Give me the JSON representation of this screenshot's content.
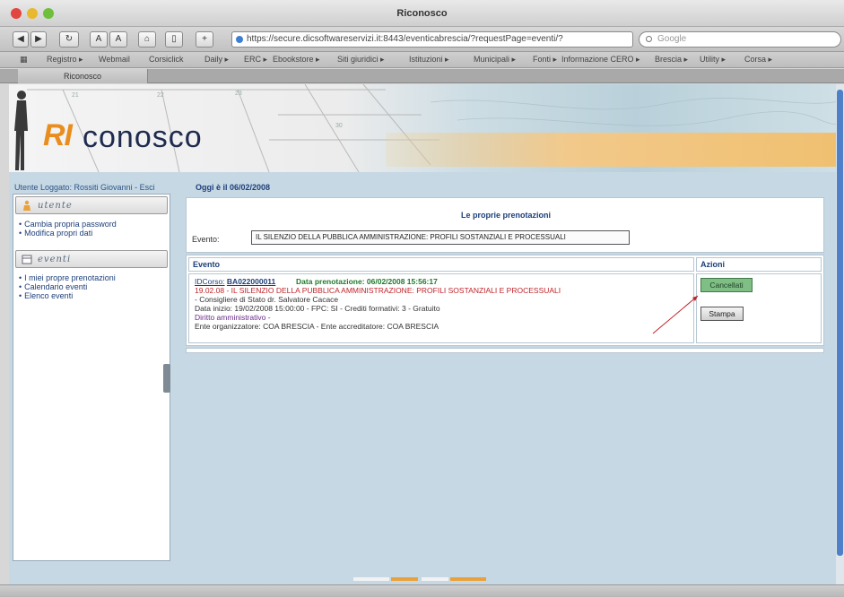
{
  "window": {
    "title": "Riconosco",
    "url": "https://secure.dicsoftwareservizi.it:8443/eventicabrescia/?requestPage=eventi/?",
    "search_placeholder": "Google"
  },
  "bookmarks": [
    "Registro ▸",
    "Webmail",
    "Corsiclick",
    "Daily ▸",
    "ERC ▸",
    "Ebookstore ▸",
    "Siti giuridici ▸",
    "Istituzioni ▸",
    "Municipali ▸",
    "Fonti ▸",
    "Informazione CERO ▸",
    "Brescia ▸",
    "Utility ▸",
    "Corsa ▸"
  ],
  "tab": {
    "label": "Riconosco"
  },
  "banner": {
    "logo_ri": "RI",
    "logo_rest": "conosco"
  },
  "user": {
    "logged_label": "Utente Loggato: Rossiti Giovanni - Esci",
    "date_label": "Oggi è il 06/02/2008"
  },
  "sidebar": {
    "section1_title": "utente",
    "section1_links": [
      "Cambia propria password",
      "Modifica propri dati"
    ],
    "section2_title": "eventi",
    "section2_links": [
      "I miei propre prenotazioni",
      "Calendario eventi",
      "Elenco eventi"
    ]
  },
  "main": {
    "title": "Le proprie prenotazioni",
    "event_label": "Evento:",
    "event_selected": "IL SILENZIO DELLA PUBBLICA AMMINISTRAZIONE: PROFILI SOSTANZIALI E PROCESSUALI",
    "col_evento": "Evento",
    "col_azioni": "Azioni",
    "row": {
      "code_label": "IDCorso:",
      "code": "BA022000011",
      "reservation": "Data prenotazione: 06/02/2008 15:56:17",
      "line2": "19.02.08 - IL SILENZIO DELLA PUBBLICA AMMINISTRAZIONE: PROFILI SOSTANZIALI E PROCESSUALI",
      "line3": "- Consigliere di Stato dr. Salvatore Cacace",
      "line4": "Data inizio: 19/02/2008 15:00:00 - FPC: SI - Crediti formativi: 3 - Gratuito",
      "line5": "Diritto amministrativo -",
      "line6": "Ente organizzatore: COA BRESCIA - Ente accreditatore: COA BRESCIA"
    },
    "btn_cancel": "Cancellati",
    "btn_print": "Stampa"
  },
  "colors": {
    "accent_orange": "#e98d1e",
    "link_blue": "#1d3f7a",
    "page_bg": "#c6d8e4"
  }
}
